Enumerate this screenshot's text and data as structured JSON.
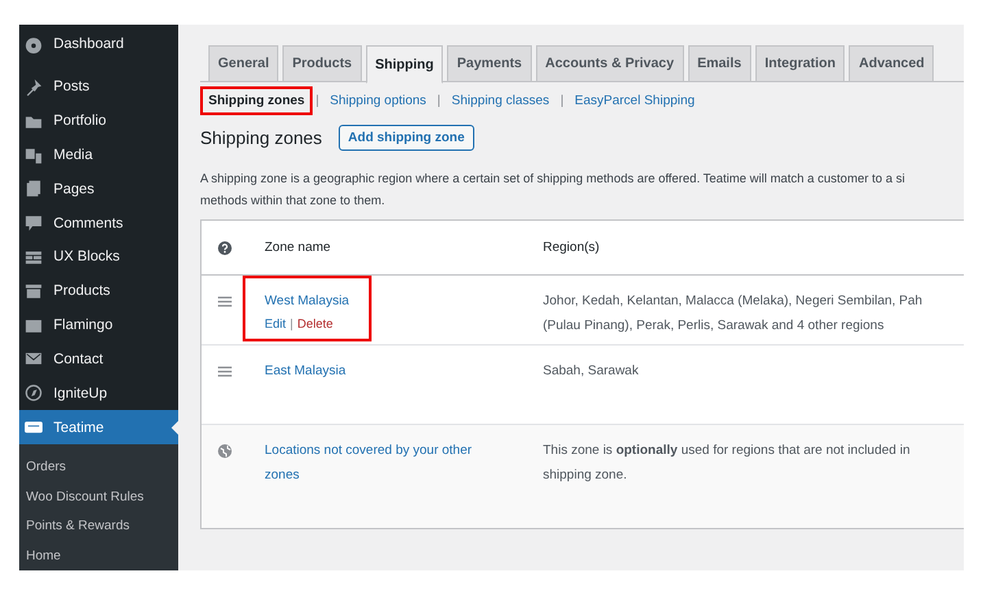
{
  "sidebar": {
    "items": [
      {
        "label": "Dashboard",
        "selected": false
      },
      {
        "label": "Posts",
        "selected": false
      },
      {
        "label": "Portfolio",
        "selected": false
      },
      {
        "label": "Media",
        "selected": false
      },
      {
        "label": "Pages",
        "selected": false
      },
      {
        "label": "Comments",
        "selected": false
      },
      {
        "label": "UX Blocks",
        "selected": false
      },
      {
        "label": "Products",
        "selected": false
      },
      {
        "label": "Flamingo",
        "selected": false
      },
      {
        "label": "Contact",
        "selected": false
      },
      {
        "label": "IgniteUp",
        "selected": false
      },
      {
        "label": "Teatime",
        "selected": true
      }
    ],
    "submenu": [
      "Orders",
      "Woo Discount Rules",
      "Points & Rewards",
      "Home"
    ]
  },
  "tabs": [
    {
      "label": "General",
      "selected": false
    },
    {
      "label": "Products",
      "selected": false
    },
    {
      "label": "Shipping",
      "selected": true
    },
    {
      "label": "Payments",
      "selected": false
    },
    {
      "label": "Accounts & Privacy",
      "selected": false
    },
    {
      "label": "Emails",
      "selected": false
    },
    {
      "label": "Integration",
      "selected": false
    },
    {
      "label": "Advanced",
      "selected": false
    }
  ],
  "subnav": [
    {
      "label": "Shipping zones",
      "selected": true,
      "highlighted": true
    },
    {
      "label": "Shipping options",
      "selected": false,
      "highlighted": false
    },
    {
      "label": "Shipping classes",
      "selected": false,
      "highlighted": false
    },
    {
      "label": "EasyParcel Shipping",
      "selected": false,
      "highlighted": false
    }
  ],
  "subnav_separator": "|",
  "heading": "Shipping zones",
  "add_button": "Add shipping zone",
  "description": [
    "A shipping zone is a geographic region where a certain set of shipping methods are offered. Teatime will match a customer to a si",
    "methods within that zone to them."
  ],
  "table": {
    "columns": [
      "Zone name",
      "Region(s)"
    ],
    "action_separator": "|",
    "rows": [
      {
        "kind": "zone",
        "name": "West Malaysia",
        "actions": [
          "Edit",
          "Delete"
        ],
        "highlighted": true,
        "regions": [
          "Johor, Kedah, Kelantan, Malacca (Melaka), Negeri Sembilan, Pah",
          "(Pulau Pinang), Perak, Perlis, Sarawak and 4 other regions"
        ]
      },
      {
        "kind": "zone",
        "name": "East Malaysia",
        "actions": [],
        "highlighted": false,
        "regions": [
          "Sabah, Sarawak"
        ]
      },
      {
        "kind": "rest",
        "name": "Locations not covered by your other zones",
        "actions": [],
        "regions": [
          "This zone is **optionally** used for regions that are not included in",
          "shipping zone."
        ]
      }
    ]
  }
}
